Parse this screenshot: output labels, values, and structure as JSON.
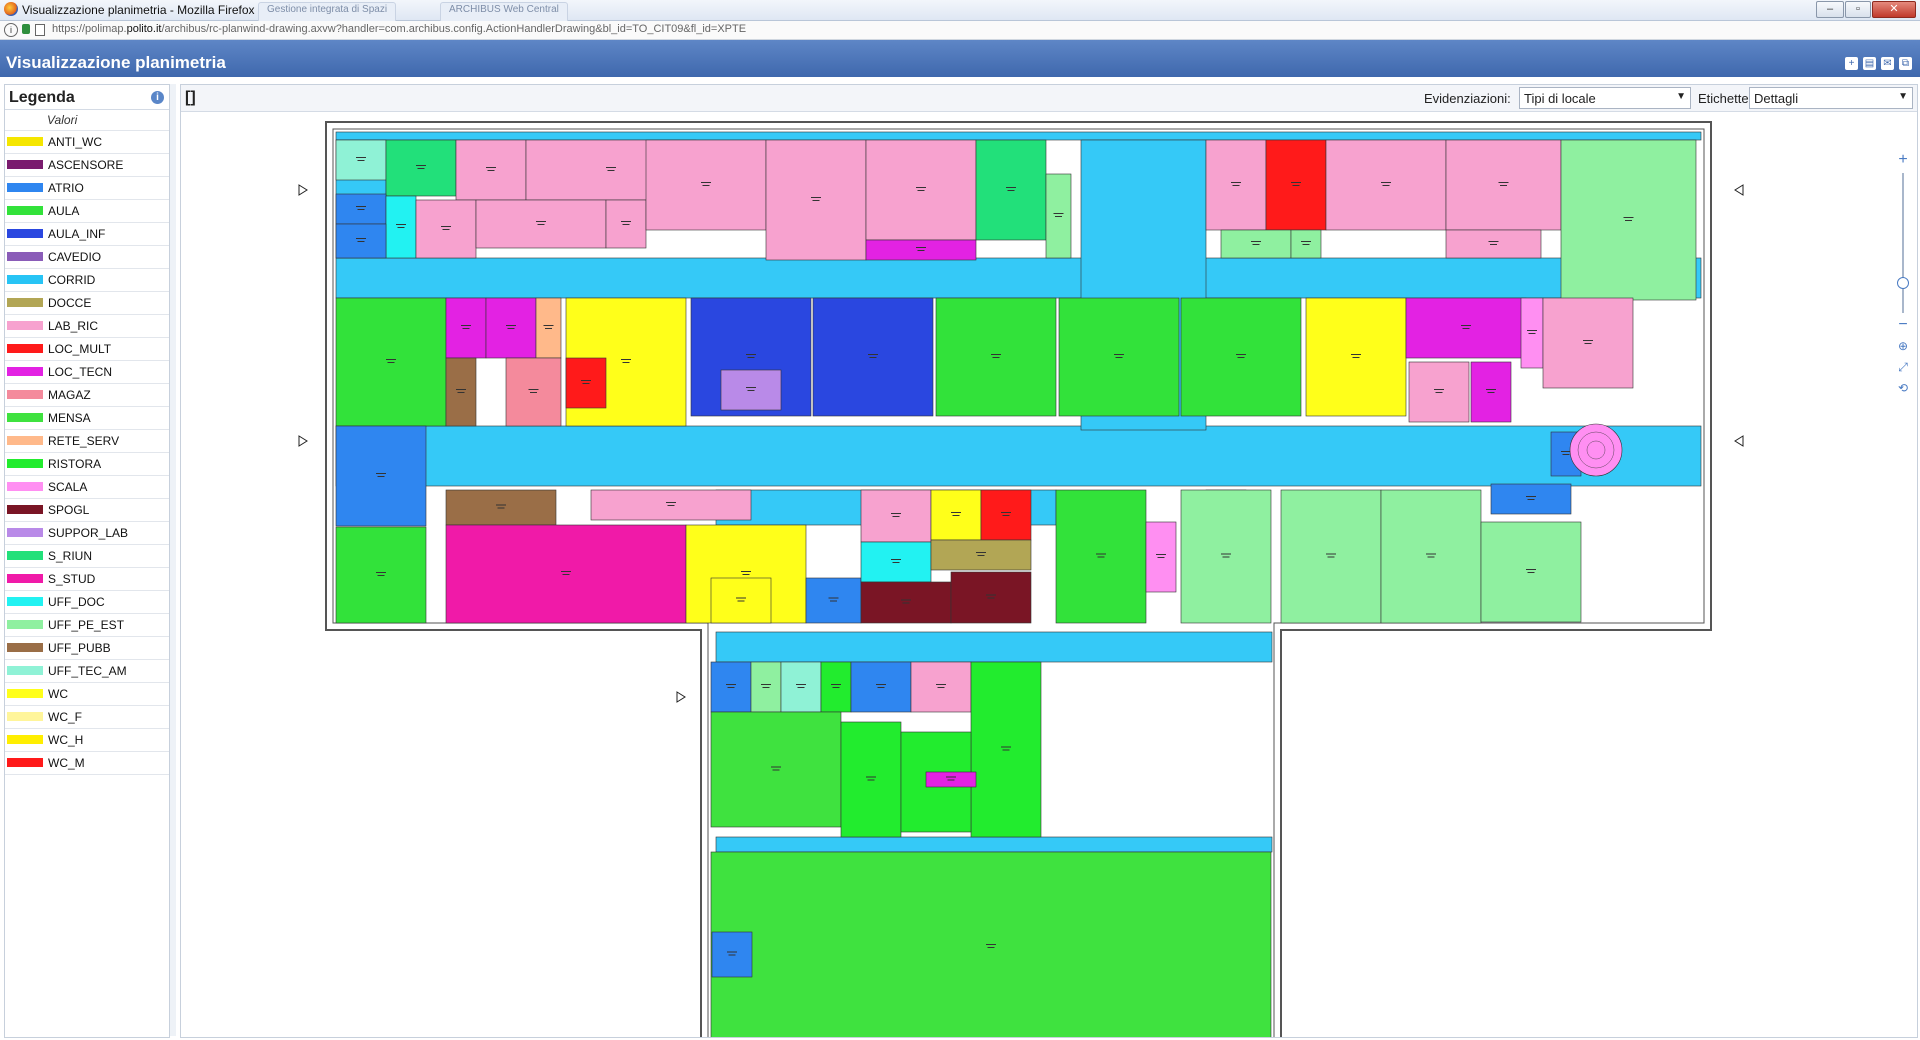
{
  "browser": {
    "window_title": "Visualizzazione planimetria - Mozilla Firefox",
    "ghost_tabs": [
      "Gestione integrata di Spazi",
      "ARCHIBUS Web Central"
    ],
    "url_prefix": "https://polimap.",
    "url_domain": "polito.it",
    "url_rest": "/archibus/rc-planwind-drawing.axvw?handler=com.archibus.config.ActionHandlerDrawing&bl_id=TO_CIT09&fl_id=XPTE",
    "info_icon": "i"
  },
  "app": {
    "title": "Visualizzazione planimetria",
    "header_icons": [
      "add-icon",
      "print-icon",
      "mail-icon",
      "sitemap-icon"
    ]
  },
  "legend": {
    "title": "Legenda",
    "column_header": "Valori",
    "items": [
      {
        "label": "ANTI_WC",
        "color": "#f5e600"
      },
      {
        "label": "ASCENSORE",
        "color": "#7a1b6e"
      },
      {
        "label": "ATRIO",
        "color": "#2f86f0"
      },
      {
        "label": "AULA",
        "color": "#32e23a"
      },
      {
        "label": "AULA_INF",
        "color": "#2a47e0"
      },
      {
        "label": "CAVEDIO",
        "color": "#8a5cb8"
      },
      {
        "label": "CORRID",
        "color": "#27c4f5"
      },
      {
        "label": "DOCCE",
        "color": "#b2a655"
      },
      {
        "label": "LAB_RIC",
        "color": "#f7a2cf"
      },
      {
        "label": "LOC_MULT",
        "color": "#ff1a1a"
      },
      {
        "label": "LOC_TECN",
        "color": "#e322e3"
      },
      {
        "label": "MAGAZ",
        "color": "#f48a9c"
      },
      {
        "label": "MENSA",
        "color": "#3fe23f"
      },
      {
        "label": "RETE_SERV",
        "color": "#ffb98a"
      },
      {
        "label": "RISTORA",
        "color": "#22ec2e"
      },
      {
        "label": "SCALA",
        "color": "#ff8ff2"
      },
      {
        "label": "SPOGL",
        "color": "#7a1525"
      },
      {
        "label": "SUPPOR_LAB",
        "color": "#b98ae8"
      },
      {
        "label": "S_RIUN",
        "color": "#22e07a"
      },
      {
        "label": "S_STUD",
        "color": "#f01aa8"
      },
      {
        "label": "UFF_DOC",
        "color": "#22f2f2"
      },
      {
        "label": "UFF_PE_EST",
        "color": "#8ff0a0"
      },
      {
        "label": "UFF_PUBB",
        "color": "#9a6e47"
      },
      {
        "label": "UFF_TEC_AM",
        "color": "#8ff2d6"
      },
      {
        "label": "WC",
        "color": "#ffff1a"
      },
      {
        "label": "WC_F",
        "color": "#fff59a"
      },
      {
        "label": "WC_H",
        "color": "#ffee00"
      },
      {
        "label": "WC_M",
        "color": "#ff1a1a"
      }
    ]
  },
  "toolbar": {
    "breadcrumb": "[]",
    "highlight_label": "Evidenziazioni:",
    "highlight_value": "Tipi di locale",
    "labels_label": "Etichette:",
    "labels_value": "Dettagli",
    "dropdown_glyph": "▼"
  },
  "zoom": {
    "zoom_in": "+",
    "zoom_out": "−",
    "level": 0.2,
    "tools": [
      "target-icon",
      "fit-icon",
      "reset-icon"
    ]
  }
}
